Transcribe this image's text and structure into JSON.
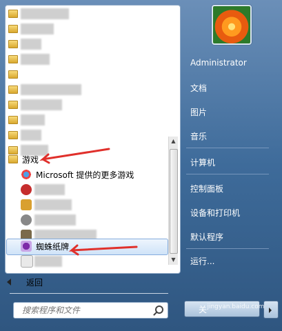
{
  "left_pane": {
    "folder_games_label": "游戏",
    "ms_games_label": "Microsoft 提供的更多游戏",
    "spider_label": "蜘蛛纸牌",
    "back_label": "返回",
    "search_placeholder": "搜索程序和文件"
  },
  "right_pane": {
    "links": [
      "Administrator",
      "文档",
      "图片",
      "音乐",
      "计算机",
      "控制面板",
      "设备和打印机",
      "默认程序",
      "运行..."
    ],
    "shutdown_label": "关"
  },
  "watermark": {
    "text": "jingyan.baidu.com"
  },
  "colors": {
    "annotation_red": "#e0302b"
  },
  "icons": [
    "folder-icon",
    "spider-solitaire-icon",
    "ms-games-icon",
    "search-icon",
    "back-arrow-icon"
  ]
}
